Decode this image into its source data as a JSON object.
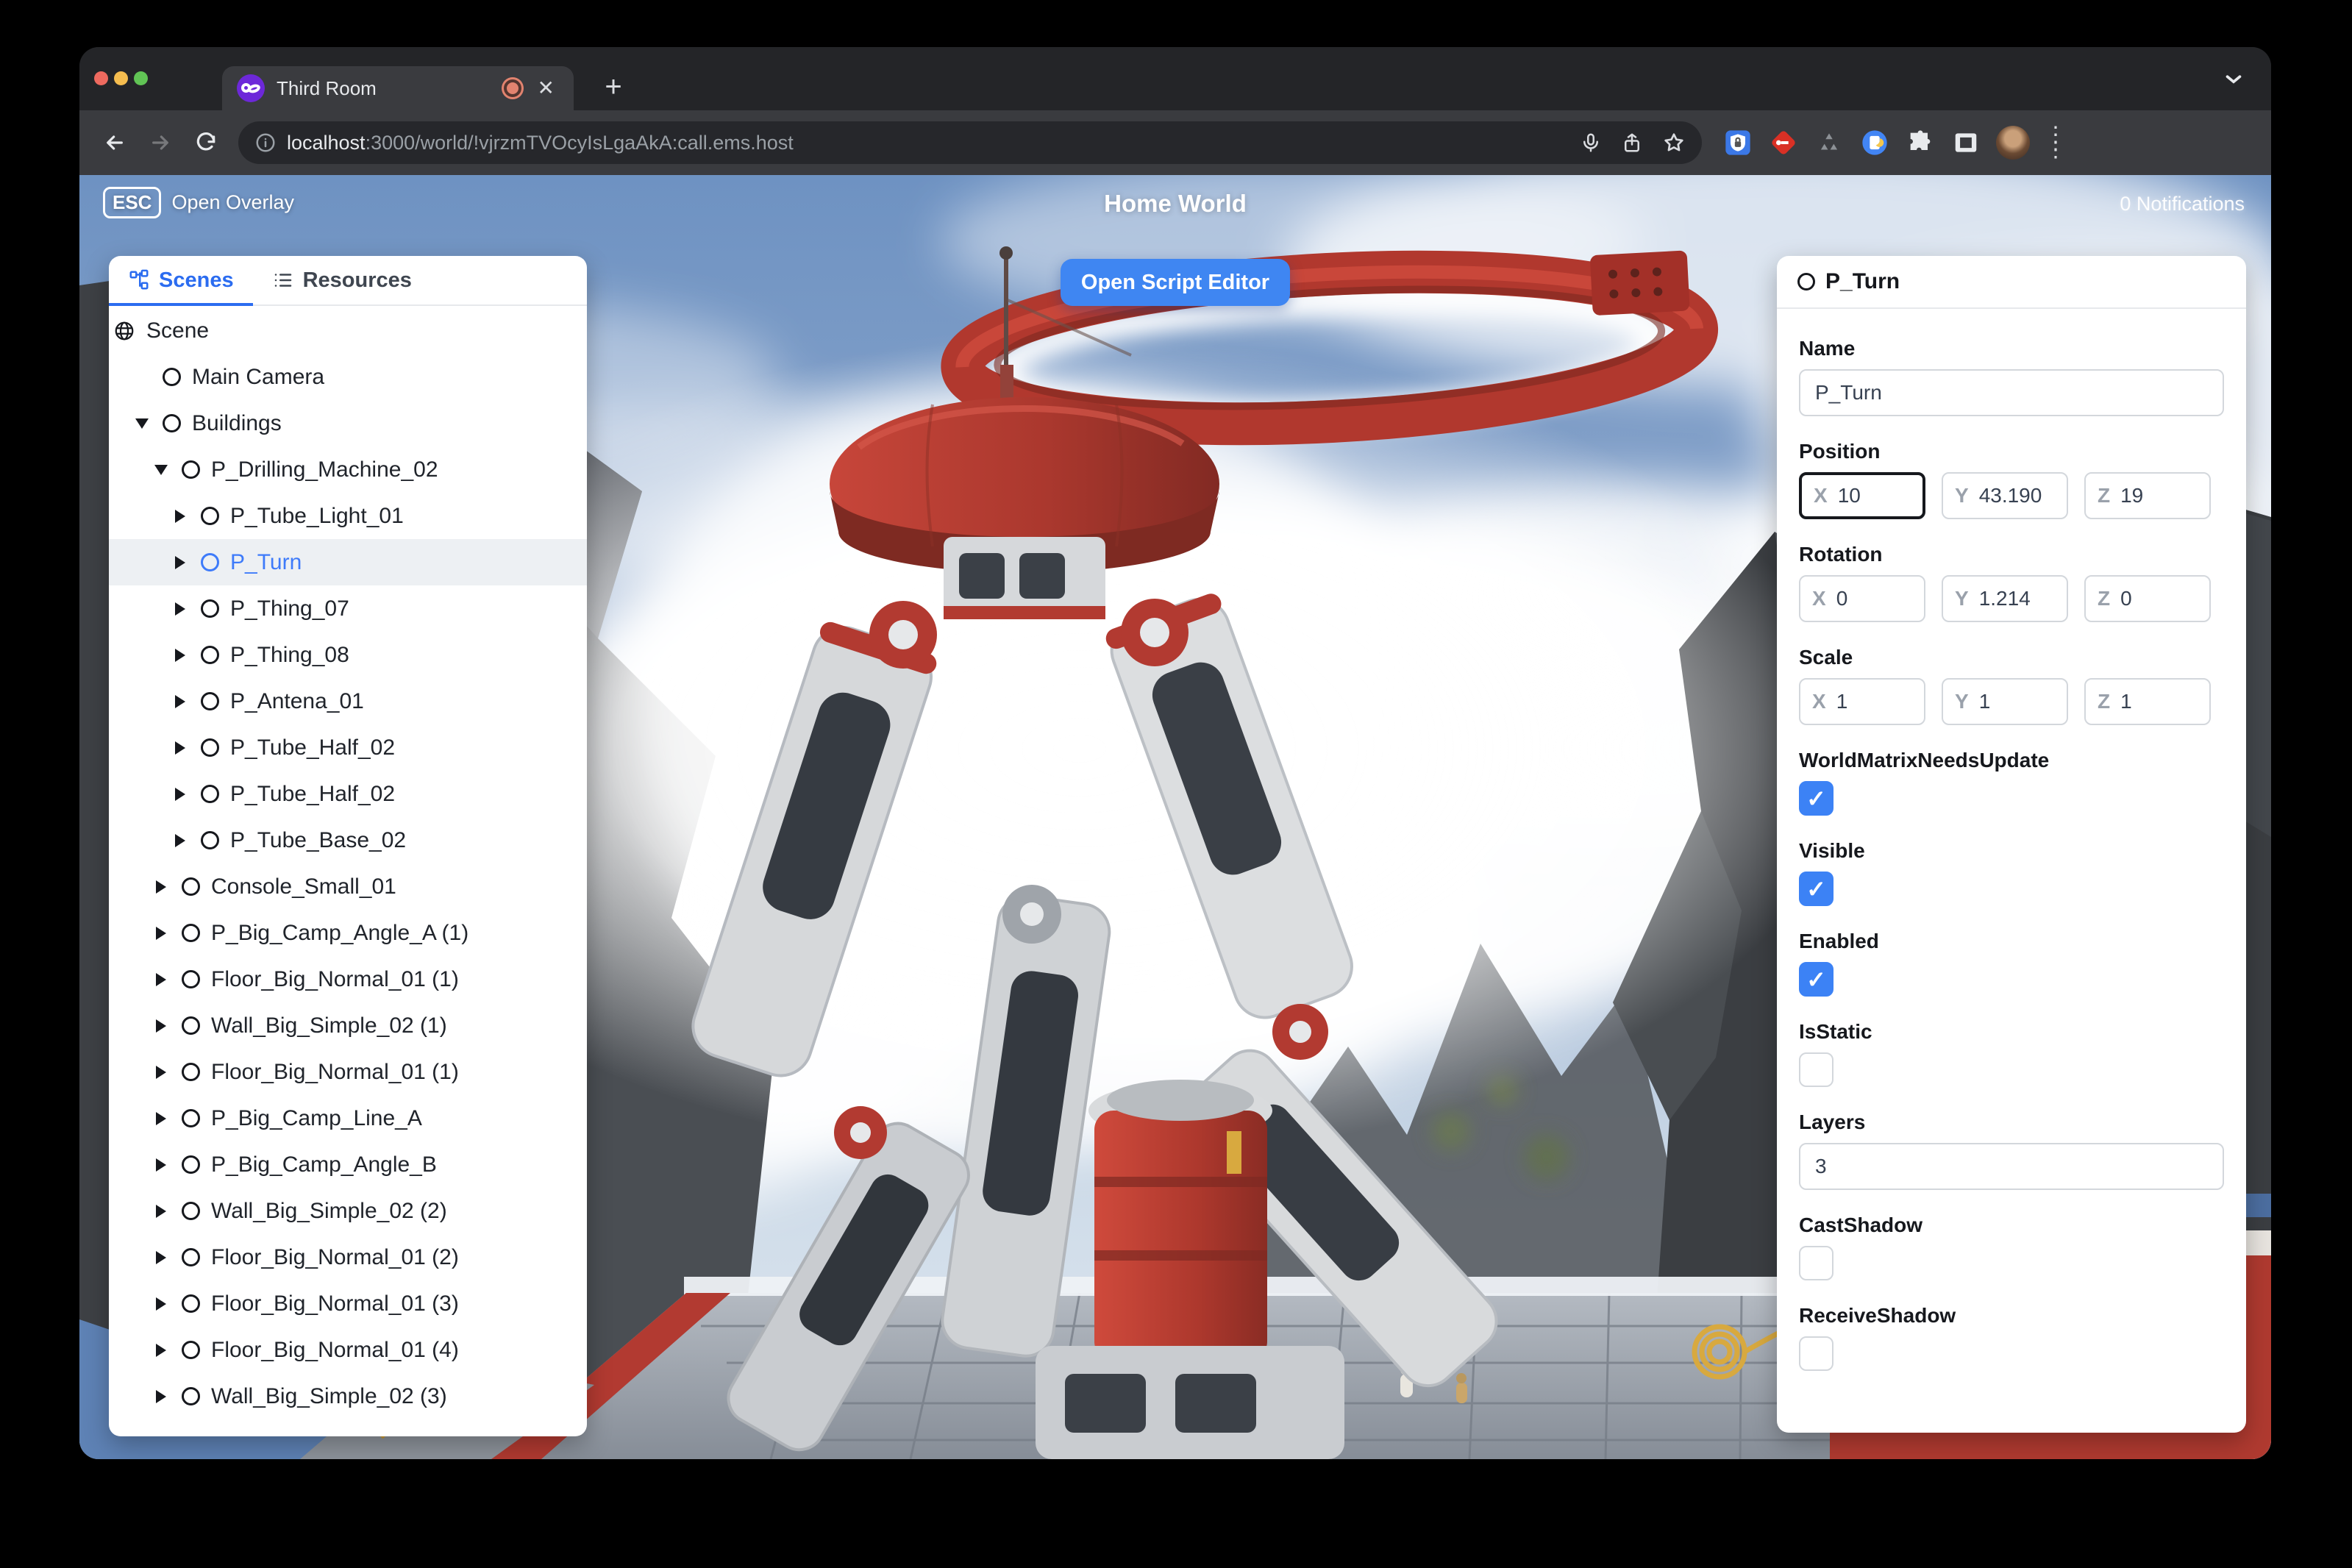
{
  "colors": {
    "accent": "#2b6cf0",
    "button": "#3f86f2",
    "checkbox": "#3c82f5",
    "selection_text": "#3e7bfa"
  },
  "browser": {
    "tab": {
      "title": "Third Room"
    },
    "new_tab_label": "+",
    "url": {
      "host": "localhost",
      "rest": ":3000/world/!vjrzmTVOcyIsLgaAkA:call.ems.host"
    }
  },
  "overlay": {
    "esc_key": "ESC",
    "esc_label": "Open Overlay",
    "title": "Home World",
    "notifications": "0 Notifications",
    "script_editor_button": "Open Script Editor"
  },
  "scenes_panel": {
    "tabs": [
      {
        "label": "Scenes",
        "active": true
      },
      {
        "label": "Resources",
        "active": false
      }
    ],
    "tree": [
      {
        "label": "Scene",
        "indent": 0,
        "arrow": null,
        "icon": "globe",
        "selected": false
      },
      {
        "label": "Main Camera",
        "indent": 1,
        "arrow": null,
        "icon": "circle",
        "selected": false
      },
      {
        "label": "Buildings",
        "indent": 1,
        "arrow": "down",
        "icon": "circle",
        "selected": false
      },
      {
        "label": "P_Drilling_Machine_02",
        "indent": 2,
        "arrow": "down",
        "icon": "circle",
        "selected": false
      },
      {
        "label": "P_Tube_Light_01",
        "indent": 3,
        "arrow": "right",
        "icon": "circle",
        "selected": false
      },
      {
        "label": "P_Turn",
        "indent": 3,
        "arrow": "right",
        "icon": "circle",
        "selected": true
      },
      {
        "label": "P_Thing_07",
        "indent": 3,
        "arrow": "right",
        "icon": "circle",
        "selected": false
      },
      {
        "label": "P_Thing_08",
        "indent": 3,
        "arrow": "right",
        "icon": "circle",
        "selected": false
      },
      {
        "label": "P_Antena_01",
        "indent": 3,
        "arrow": "right",
        "icon": "circle",
        "selected": false
      },
      {
        "label": "P_Tube_Half_02",
        "indent": 3,
        "arrow": "right",
        "icon": "circle",
        "selected": false
      },
      {
        "label": "P_Tube_Half_02",
        "indent": 3,
        "arrow": "right",
        "icon": "circle",
        "selected": false
      },
      {
        "label": "P_Tube_Base_02",
        "indent": 3,
        "arrow": "right",
        "icon": "circle",
        "selected": false
      },
      {
        "label": "Console_Small_01",
        "indent": 2,
        "arrow": "right",
        "icon": "circle",
        "selected": false
      },
      {
        "label": "P_Big_Camp_Angle_A (1)",
        "indent": 2,
        "arrow": "right",
        "icon": "circle",
        "selected": false
      },
      {
        "label": "Floor_Big_Normal_01 (1)",
        "indent": 2,
        "arrow": "right",
        "icon": "circle",
        "selected": false
      },
      {
        "label": "Wall_Big_Simple_02 (1)",
        "indent": 2,
        "arrow": "right",
        "icon": "circle",
        "selected": false
      },
      {
        "label": "Floor_Big_Normal_01 (1)",
        "indent": 2,
        "arrow": "right",
        "icon": "circle",
        "selected": false
      },
      {
        "label": "P_Big_Camp_Line_A",
        "indent": 2,
        "arrow": "right",
        "icon": "circle",
        "selected": false
      },
      {
        "label": "P_Big_Camp_Angle_B",
        "indent": 2,
        "arrow": "right",
        "icon": "circle",
        "selected": false
      },
      {
        "label": "Wall_Big_Simple_02 (2)",
        "indent": 2,
        "arrow": "right",
        "icon": "circle",
        "selected": false
      },
      {
        "label": "Floor_Big_Normal_01 (2)",
        "indent": 2,
        "arrow": "right",
        "icon": "circle",
        "selected": false
      },
      {
        "label": "Floor_Big_Normal_01 (3)",
        "indent": 2,
        "arrow": "right",
        "icon": "circle",
        "selected": false
      },
      {
        "label": "Floor_Big_Normal_01 (4)",
        "indent": 2,
        "arrow": "right",
        "icon": "circle",
        "selected": false
      },
      {
        "label": "Wall_Big_Simple_02 (3)",
        "indent": 2,
        "arrow": "right",
        "icon": "circle",
        "selected": false
      }
    ]
  },
  "inspector": {
    "title": "P_Turn",
    "fields": [
      {
        "type": "text",
        "label": "Name",
        "value": "P_Turn"
      },
      {
        "type": "vector",
        "label": "Position",
        "axes": [
          {
            "axis": "X",
            "value": "10",
            "focused": true
          },
          {
            "axis": "Y",
            "value": "43.190",
            "focused": false
          },
          {
            "axis": "Z",
            "value": "19",
            "focused": false
          }
        ]
      },
      {
        "type": "vector",
        "label": "Rotation",
        "axes": [
          {
            "axis": "X",
            "value": "0",
            "focused": false
          },
          {
            "axis": "Y",
            "value": "1.214",
            "focused": false
          },
          {
            "axis": "Z",
            "value": "0",
            "focused": false
          }
        ]
      },
      {
        "type": "vector",
        "label": "Scale",
        "axes": [
          {
            "axis": "X",
            "value": "1",
            "focused": false
          },
          {
            "axis": "Y",
            "value": "1",
            "focused": false
          },
          {
            "axis": "Z",
            "value": "1",
            "focused": false
          }
        ]
      },
      {
        "type": "checkbox",
        "label": "WorldMatrixNeedsUpdate",
        "checked": true
      },
      {
        "type": "checkbox",
        "label": "Visible",
        "checked": true
      },
      {
        "type": "checkbox",
        "label": "Enabled",
        "checked": true
      },
      {
        "type": "checkbox",
        "label": "IsStatic",
        "checked": false
      },
      {
        "type": "text",
        "label": "Layers",
        "value": "3"
      },
      {
        "type": "checkbox",
        "label": "CastShadow",
        "checked": false
      },
      {
        "type": "checkbox",
        "label": "ReceiveShadow",
        "checked": false
      }
    ]
  }
}
